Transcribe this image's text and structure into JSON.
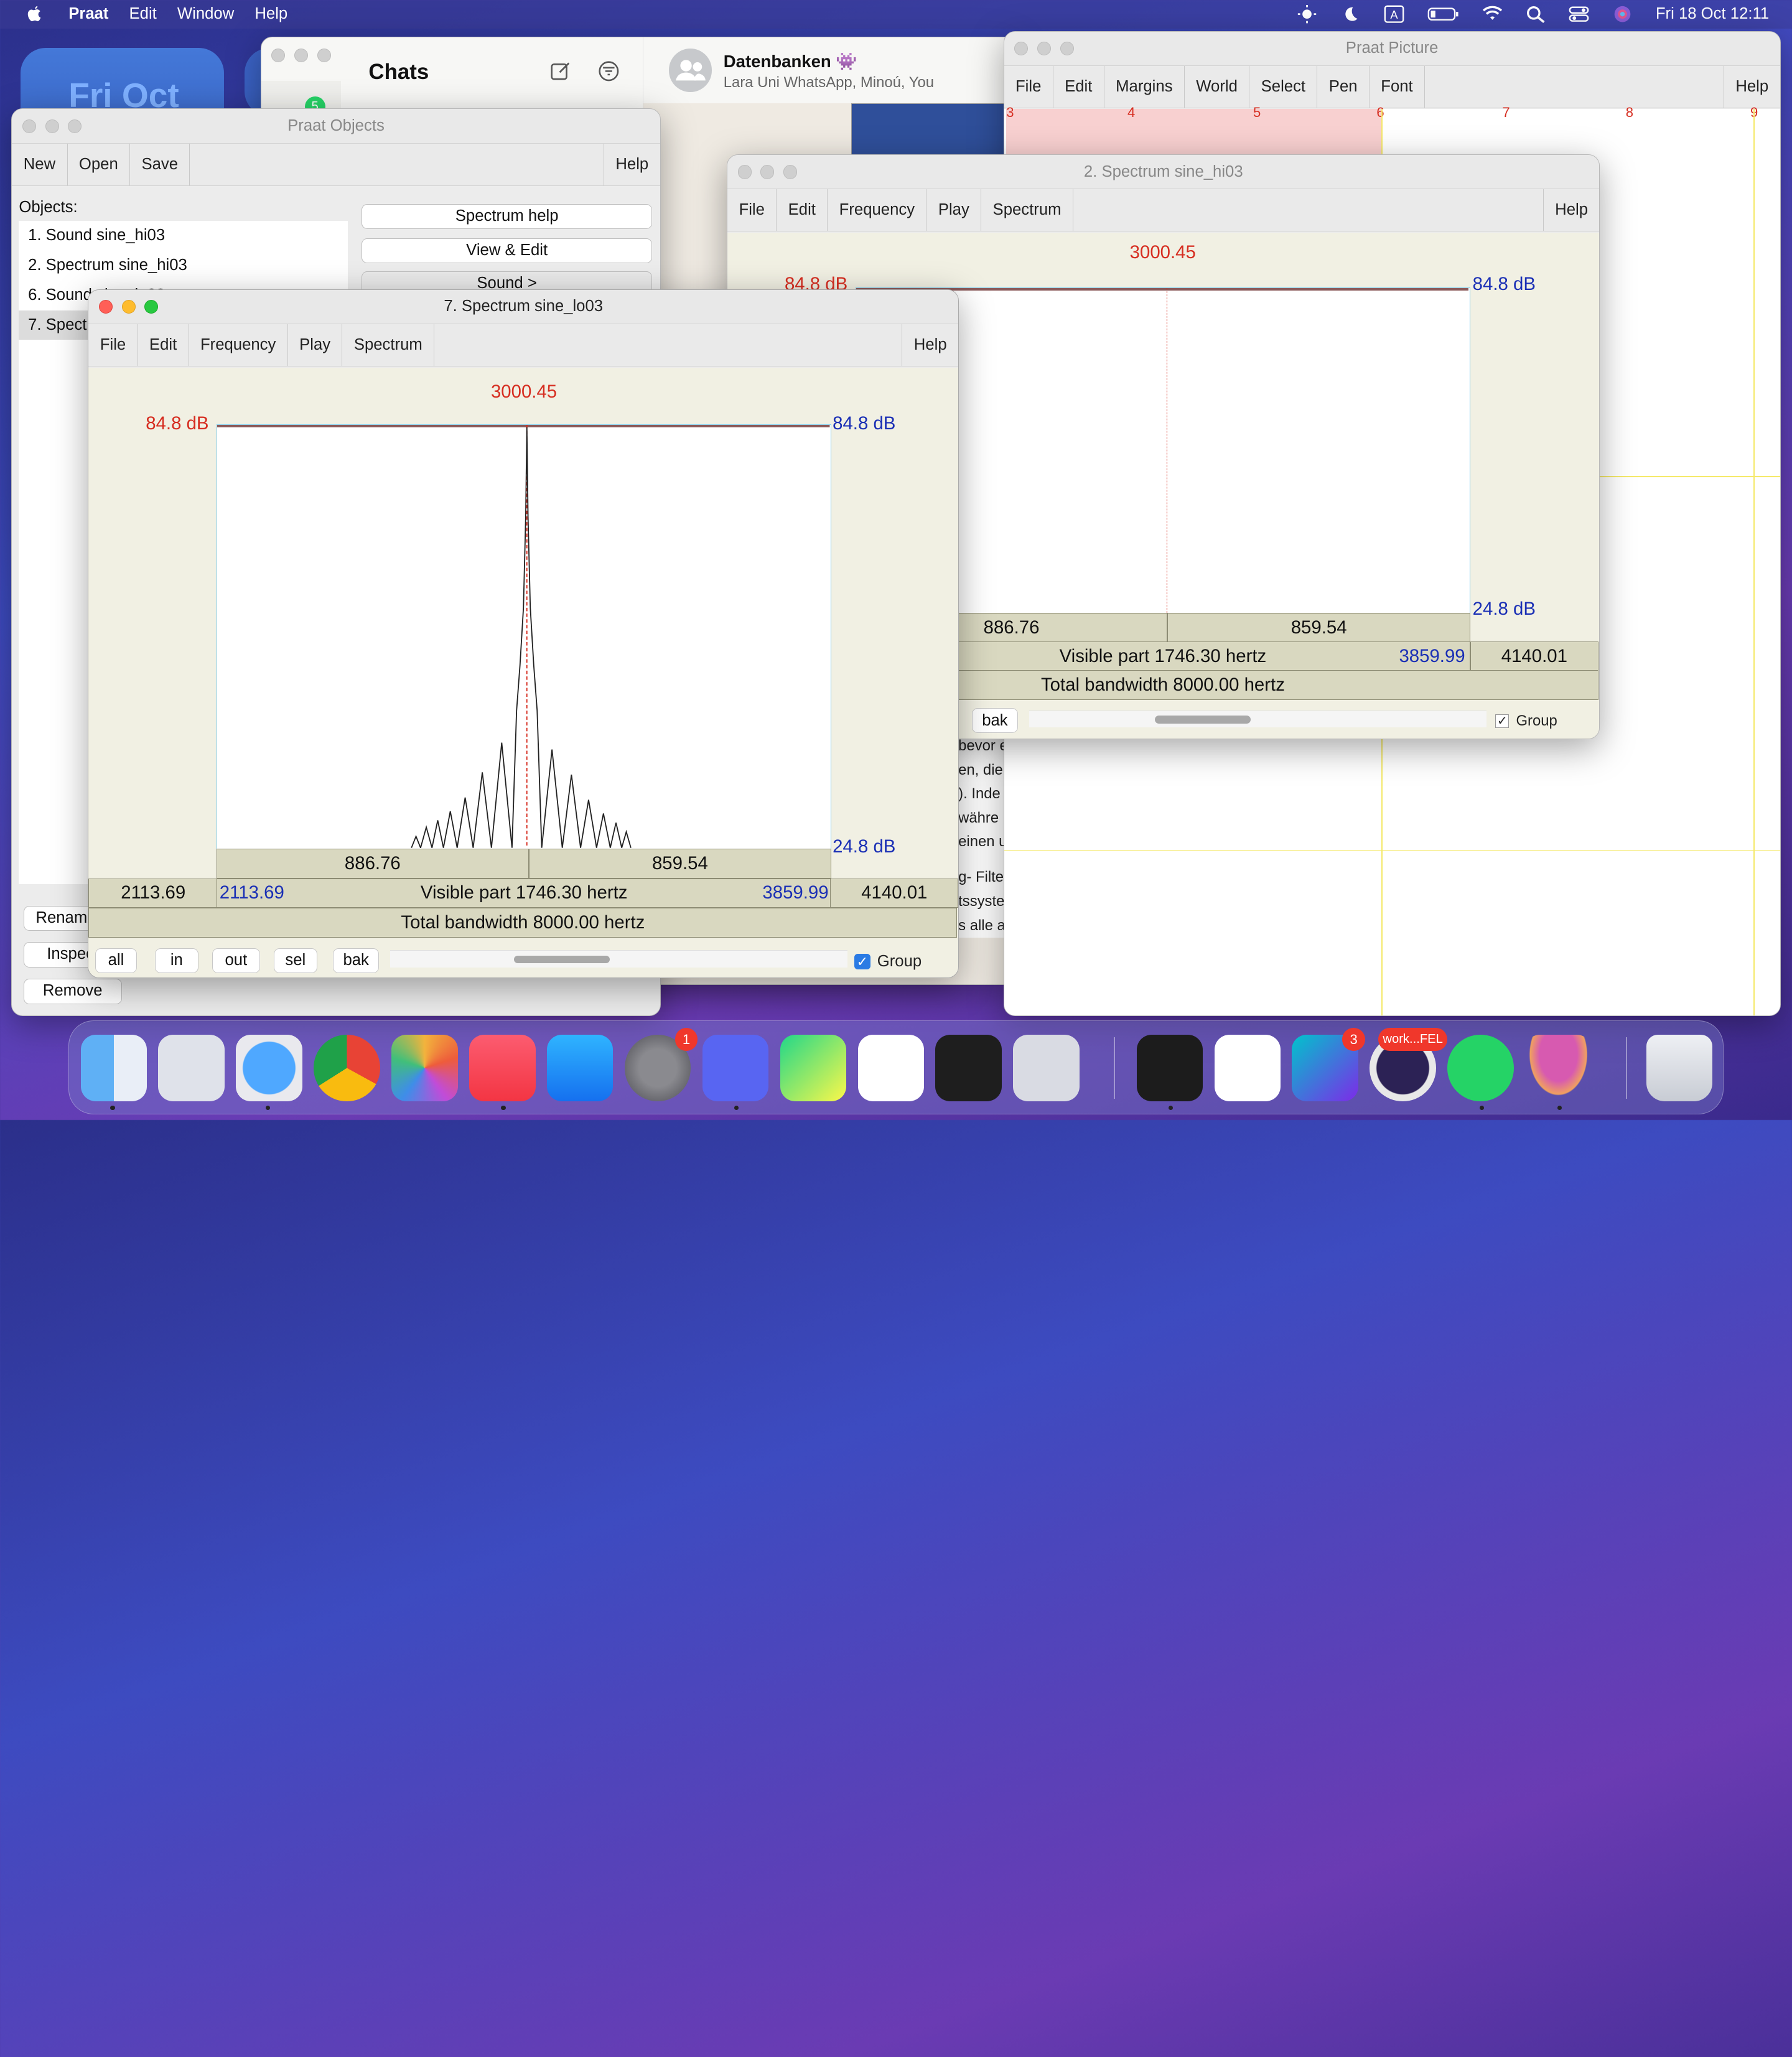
{
  "menubar": {
    "app": "Praat",
    "items": [
      "Edit",
      "Window",
      "Help"
    ],
    "clock": "Fri 18 Oct  12:11"
  },
  "widget": {
    "date": "Fri Oct"
  },
  "whatsapp": {
    "title": "Chats",
    "chat_name": "Datenbanken 👾",
    "chat_members": "Lara Uni WhatsApp, Minoú, You",
    "badge": "5",
    "text_fragments": [
      "bevor e",
      "en, die",
      "). Inde",
      "währe",
      "einen u",
      "g- Filte",
      "tssyste",
      "s alle a"
    ]
  },
  "praat_objects": {
    "title": "Praat Objects",
    "toolbar": [
      "New",
      "Open",
      "Save"
    ],
    "help": "Help",
    "objects_label": "Objects:",
    "objects": [
      "1. Sound sine_hi03",
      "2. Spectrum sine_hi03",
      "6. Sound sine_lo03",
      "7. Spectrum sine_lo03"
    ],
    "buttons": [
      "Spectrum help",
      "View & Edit",
      "Sound  >"
    ],
    "bottom_buttons": [
      "Rename...",
      "Inspect",
      "Remove"
    ]
  },
  "praat_picture": {
    "title": "Praat Picture",
    "menu": [
      "File",
      "Edit",
      "Margins",
      "World",
      "Select",
      "Pen",
      "Font"
    ],
    "help": "Help",
    "ruler": [
      "3",
      "4",
      "5",
      "6",
      "7",
      "8",
      "9"
    ]
  },
  "spectrum_hi": {
    "title": "2. Spectrum sine_hi03",
    "menu": [
      "File",
      "Edit",
      "Frequency",
      "Play",
      "Spectrum"
    ],
    "help": "Help",
    "cursor": "3000.45",
    "top_db_left": "84.8 dB",
    "top_db_right": "84.8 dB",
    "bottom_db": "24.8 dB",
    "left_width": "886.76",
    "right_width": "859.54",
    "visible": "Visible part 1746.30 hertz",
    "visible_end": "3859.99",
    "right_rest": "4140.01",
    "total": "Total bandwidth 8000.00 hertz",
    "bak": "bak",
    "group": "Group"
  },
  "spectrum_lo": {
    "title": "7. Spectrum sine_lo03",
    "menu": [
      "File",
      "Edit",
      "Frequency",
      "Play",
      "Spectrum"
    ],
    "help": "Help",
    "cursor": "3000.45",
    "top_db_left": "84.8 dB",
    "top_db_right": "84.8 dB",
    "bottom_db": "24.8 dB",
    "left_width": "886.76",
    "right_width": "859.54",
    "left_rest": "2113.69",
    "visible_start": "2113.69",
    "visible": "Visible part 1746.30 hertz",
    "visible_end": "3859.99",
    "right_rest": "4140.01",
    "total": "Total bandwidth 8000.00 hertz",
    "buttons": [
      "all",
      "in",
      "out",
      "sel",
      "bak"
    ],
    "group": "Group"
  },
  "dock": {
    "apps": [
      "finder-icon",
      "launchpad-icon",
      "safari-icon",
      "chrome-icon",
      "photos-icon",
      "music-icon",
      "appstore-icon",
      "settings-icon",
      "discord-icon",
      "pycharm-icon",
      "vscode-icon",
      "figma-icon",
      "iphone-mirroring-icon",
      "terminal-icon",
      "vscode-icon",
      "canva-icon",
      "eclipse-icon",
      "whatsapp-icon",
      "praat-icon",
      "trash-icon"
    ],
    "settings_badge": "1",
    "canva_badge": "3",
    "eclipse_label": "work...FEL"
  },
  "colors": {
    "cursor_red": "#d62d20",
    "blue": "#1a2fb5",
    "plot_border": "#7fcdee",
    "cell": "#d9d8c0",
    "editor_bg": "#f1f0e3"
  }
}
